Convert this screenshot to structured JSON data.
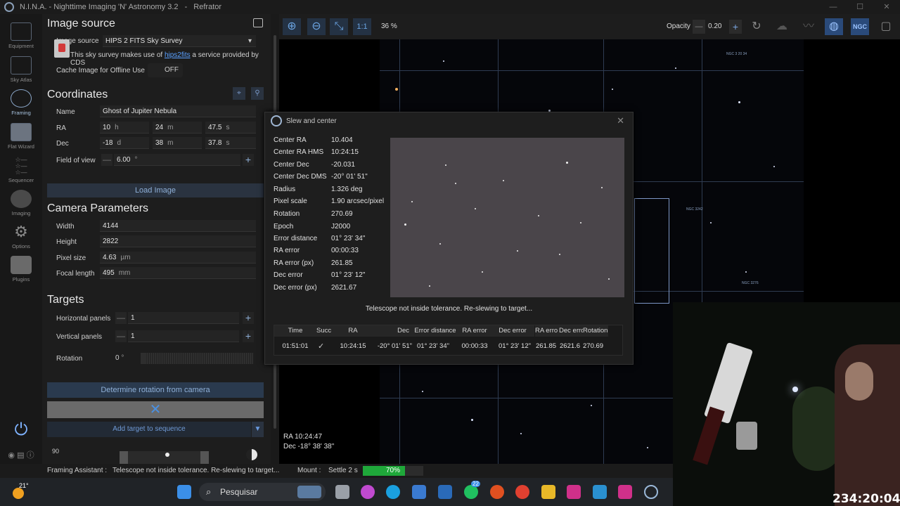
{
  "window": {
    "app_name": "N.I.N.A. - Nighttime Imaging 'N' Astronomy 3.2",
    "separator": "-",
    "profile": "Refrator"
  },
  "nav": [
    {
      "label": "Equipment",
      "icon": "equipment-icon"
    },
    {
      "label": "Sky Atlas",
      "icon": "sky-atlas-icon"
    },
    {
      "label": "Framing",
      "icon": "framing-icon"
    },
    {
      "label": "Flat Wizard",
      "icon": "flat-wizard-icon"
    },
    {
      "label": "Sequencer",
      "icon": "sequencer-icon"
    },
    {
      "label": "Imaging",
      "icon": "imaging-icon"
    },
    {
      "label": "Options",
      "icon": "options-icon"
    },
    {
      "label": "Plugins",
      "icon": "plugins-icon"
    }
  ],
  "image_source": {
    "heading": "Image source",
    "label": "Image source",
    "value": "HIPS 2 FITS Sky Survey",
    "credit_prefix": "This sky survey makes use of",
    "credit_link": "hips2fits",
    "credit_suffix": "a service provided by CDS",
    "cache_label": "Cache Image for Offline Use",
    "cache_value": "OFF"
  },
  "coordinates": {
    "heading": "Coordinates",
    "name_label": "Name",
    "name_value": "Ghost of Jupiter Nebula",
    "ra_label": "RA",
    "ra_h": "10",
    "ra_h_unit": "h",
    "ra_m": "24",
    "ra_m_unit": "m",
    "ra_s": "47.5",
    "ra_s_unit": "s",
    "dec_label": "Dec",
    "dec_d": "-18",
    "dec_d_unit": "d",
    "dec_m": "38",
    "dec_m_unit": "m",
    "dec_s": "37.8",
    "dec_s_unit": "s",
    "fov_label": "Field of view",
    "fov_value": "6.00",
    "fov_unit": "°",
    "load_image": "Load Image"
  },
  "camera": {
    "heading": "Camera Parameters",
    "width_label": "Width",
    "width_value": "4144",
    "height_label": "Height",
    "height_value": "2822",
    "pixel_label": "Pixel size",
    "pixel_value": "4.63",
    "pixel_unit": "µm",
    "focal_label": "Focal length",
    "focal_value": "495",
    "focal_unit": "mm"
  },
  "targets": {
    "heading": "Targets",
    "hpanels_label": "Horizontal panels",
    "hpanels_value": "1",
    "vpanels_label": "Vertical panels",
    "vpanels_value": "1",
    "rotation_label": "Rotation",
    "rotation_value": "0",
    "rotation_unit": "°",
    "determine_rotation": "Determine rotation from camera",
    "add_target": "Add target to sequence",
    "altitude_tick": "90"
  },
  "toolbar": {
    "one_to_one": "1:1",
    "zoom": "36 %",
    "opacity_label": "Opacity",
    "opacity_value": "0.20",
    "ngc": "NGC"
  },
  "sky": {
    "ra_readout": "RA  10:24:47",
    "dec_readout": "Dec  -18° 38' 38\"",
    "labels": [
      "NGC 3 20 34",
      "NGC 3242",
      "NGC 3276"
    ]
  },
  "dialog": {
    "title": "Slew and center",
    "close": "✕",
    "fields": [
      {
        "k": "Center RA",
        "v": "10.404"
      },
      {
        "k": "Center RA HMS",
        "v": "10:24:15"
      },
      {
        "k": "Center Dec",
        "v": "-20.031"
      },
      {
        "k": "Center Dec DMS",
        "v": "-20° 01' 51\""
      },
      {
        "k": "Radius",
        "v": "1.326 deg"
      },
      {
        "k": "Pixel scale",
        "v": "1.90 arcsec/pixel"
      },
      {
        "k": "Rotation",
        "v": "270.69"
      },
      {
        "k": "Epoch",
        "v": "J2000"
      },
      {
        "k": "Error distance",
        "v": "01° 23' 34\""
      },
      {
        "k": "RA error",
        "v": "00:00:33"
      },
      {
        "k": "RA error (px)",
        "v": "261.85"
      },
      {
        "k": "Dec error",
        "v": "01° 23' 12\""
      },
      {
        "k": "Dec error (px)",
        "v": "2621.67"
      }
    ],
    "message": "Telescope not inside tolerance. Re-slewing to target...",
    "table": {
      "headers": [
        "Time",
        "Succ",
        "RA",
        "Dec",
        "Error distance",
        "RA error",
        "Dec error",
        "RA erro",
        "Dec erro",
        "Rotation"
      ],
      "rows": [
        [
          "01:51:01",
          "✓",
          "10:24:15",
          "-20° 01' 51\"",
          "01° 23' 34\"",
          "00:00:33",
          "01° 23' 12\"",
          "261.85",
          "2621.6",
          "270.69"
        ]
      ]
    }
  },
  "status": {
    "module": "Framing Assistant :",
    "message": "Telescope not inside tolerance. Re-slewing to target...",
    "mount_label": "Mount :",
    "mount_value": "Settle 2 s",
    "progress_text": "70%",
    "progress": 0.7
  },
  "taskbar": {
    "weather": "21°",
    "search_placeholder": "Pesquisar",
    "badge": "22",
    "clock": "234:20:04"
  }
}
